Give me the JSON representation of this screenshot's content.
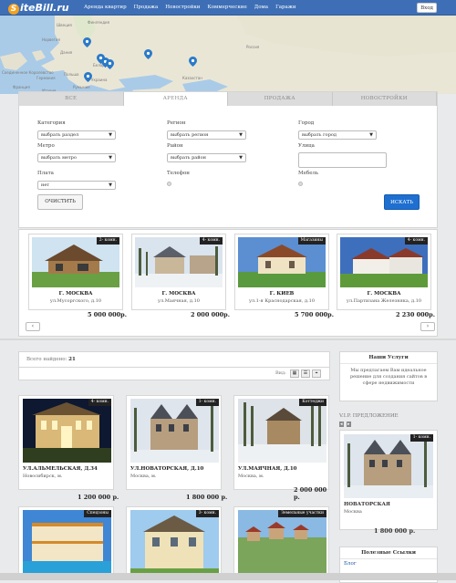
{
  "header": {
    "logo_mark": "S",
    "logo_text": "iteBill.ru",
    "nav": [
      "Аренда квартир",
      "Продажа",
      "Новостройки",
      "Коммерческие",
      "Дома",
      "Гаражи"
    ],
    "login_label": "Вход"
  },
  "map": {
    "labels": [
      "Швеция",
      "Финляндия",
      "Норвегия",
      "Дания",
      "Беларусь",
      "Соединенное Королевство",
      "Германия",
      "Польша",
      "Украина",
      "Франция",
      "Италия",
      "Румыния",
      "Казахстан",
      "Россия"
    ]
  },
  "search": {
    "tabs": [
      {
        "label": "ВСЕ",
        "active": false
      },
      {
        "label": "АРЕНДА",
        "active": true
      },
      {
        "label": "ПРОДАЖА",
        "active": false
      },
      {
        "label": "НОВОСТРОЙКИ",
        "active": false
      }
    ],
    "category_label": "Категория",
    "category_value": "выбрать раздел",
    "region_label": "Регион",
    "region_value": "выбрать регион",
    "city_label": "Город",
    "city_value": "выбрать город",
    "metro_label": "Метро",
    "metro_value": "выбрать метро",
    "district_label": "Район",
    "district_value": "выбрать район",
    "street_label": "Улица",
    "street_value": "",
    "price_label": "Плата",
    "price_value": "нет",
    "phone_label": "Телефон",
    "furniture_label": "Мебель",
    "clear_label": "ОЧИСТИТЬ",
    "search_label": "ИСКАТЬ"
  },
  "carousel": {
    "items": [
      {
        "badge": "2- комн.",
        "city": "Г. МОСКВА",
        "address": "ул.Мусоргского, д.10",
        "price": "5 000 000р."
      },
      {
        "badge": "4- комн.",
        "city": "Г. МОСКВА",
        "address": "ул.Маячная, д.10",
        "price": "2 000 000р."
      },
      {
        "badge": "Магазины",
        "city": "Г. КИЕВ",
        "address": "ул.1-я Краснодарская, д.10",
        "price": "5 700 000р."
      },
      {
        "badge": "4- комн.",
        "city": "Г. МОСКВА",
        "address": "ул.Партизана Железняка, д.10",
        "price": "2 230 000р."
      }
    ],
    "prev": "‹",
    "next": "›"
  },
  "listing": {
    "found_label": "Всего найдено:",
    "found_count": "21",
    "view_label": "Вид:",
    "cards": [
      {
        "badge": "4- комн.",
        "title": "УЛ.АЛЬМЕЛЬСКАЯ, Д.34",
        "location": "Новосибирск, м.",
        "price": "1 200 000 р."
      },
      {
        "badge": "1- комн.",
        "title": "УЛ.НОВАТОРСКАЯ, Д.10",
        "location": "Москва, м.",
        "price": "1 800 000 р."
      },
      {
        "badge": "Коттеджи",
        "title": "УЛ.МАЯЧНАЯ, Д.10",
        "location": "Москва, м.",
        "price": "2 000 000 р."
      },
      {
        "badge": "Спецзоны",
        "title": "",
        "location": "",
        "price": ""
      },
      {
        "badge": "3- комн.",
        "title": "",
        "location": "",
        "price": ""
      },
      {
        "badge": "Земельные участки",
        "title": "",
        "location": "",
        "price": ""
      }
    ]
  },
  "sidebar": {
    "services_title": "Наши Услуги",
    "services_text": "Мы предлагаем Вам идеальное решение для создания сайтов в сфере недвижимости",
    "vip_label": "V.I.P. ПРЕДЛОЖЕНИЕ",
    "vip": {
      "badge": "1- комн.",
      "title": "НОВАТОРСКАЯ",
      "location": "Москва",
      "price": "1 800 000 р."
    },
    "links_title": "Полезные Ссылки",
    "links_first": "Блог"
  }
}
